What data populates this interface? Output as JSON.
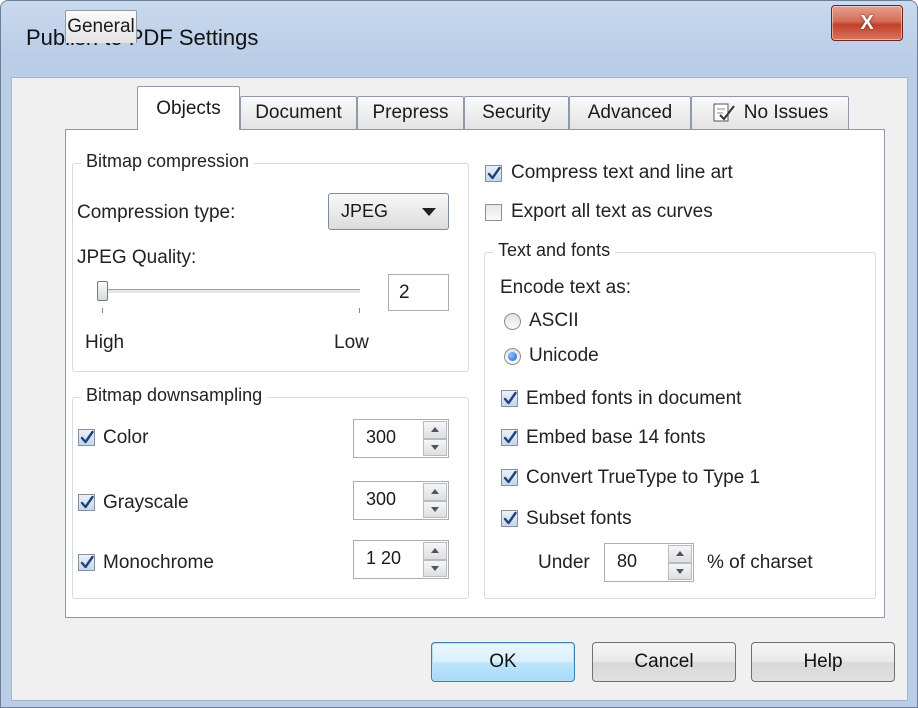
{
  "window": {
    "title": "Publish to PDF Settings",
    "close_label": "X"
  },
  "tabs": [
    {
      "label": "General"
    },
    {
      "label": "Objects",
      "active": true
    },
    {
      "label": "Document"
    },
    {
      "label": "Prepress"
    },
    {
      "label": "Security"
    },
    {
      "label": "Advanced"
    },
    {
      "label": "No Issues",
      "icon": "check-document-icon"
    }
  ],
  "bitmap_compression": {
    "title": "Bitmap compression",
    "compression_type_label": "Compression type:",
    "compression_type_value": "JPEG",
    "jpeg_quality_label": "JPEG Quality:",
    "jpeg_quality_value": "2",
    "jpeg_quality_level": 0.0,
    "slider_min_label": "High",
    "slider_max_label": "Low"
  },
  "bitmap_downsampling": {
    "title": "Bitmap downsampling",
    "items": [
      {
        "label": "Color",
        "checked": true,
        "value": "300"
      },
      {
        "label": "Grayscale",
        "checked": true,
        "value": "300"
      },
      {
        "label": "Monochrome",
        "checked": true,
        "value": "1 20"
      }
    ]
  },
  "options": {
    "compress_text": {
      "label": "Compress text and line art",
      "checked": true
    },
    "export_curves": {
      "label": "Export all text as curves",
      "checked": false
    }
  },
  "text_and_fonts": {
    "title": "Text and fonts",
    "encode_label": "Encode text as:",
    "ascii_label": "ASCII",
    "unicode_label": "Unicode",
    "encoding_selected": "Unicode",
    "embed_fonts": {
      "label": "Embed fonts in document",
      "checked": true
    },
    "embed_base14": {
      "label": "Embed base 14 fonts",
      "checked": true
    },
    "convert_truetype": {
      "label": "Convert TrueType to Type 1",
      "checked": true
    },
    "subset_fonts": {
      "label": "Subset fonts",
      "checked": true
    },
    "under_label": "Under",
    "under_value": "80",
    "charset_suffix": "% of charset"
  },
  "buttons": {
    "ok": "OK",
    "cancel": "Cancel",
    "help": "Help"
  }
}
